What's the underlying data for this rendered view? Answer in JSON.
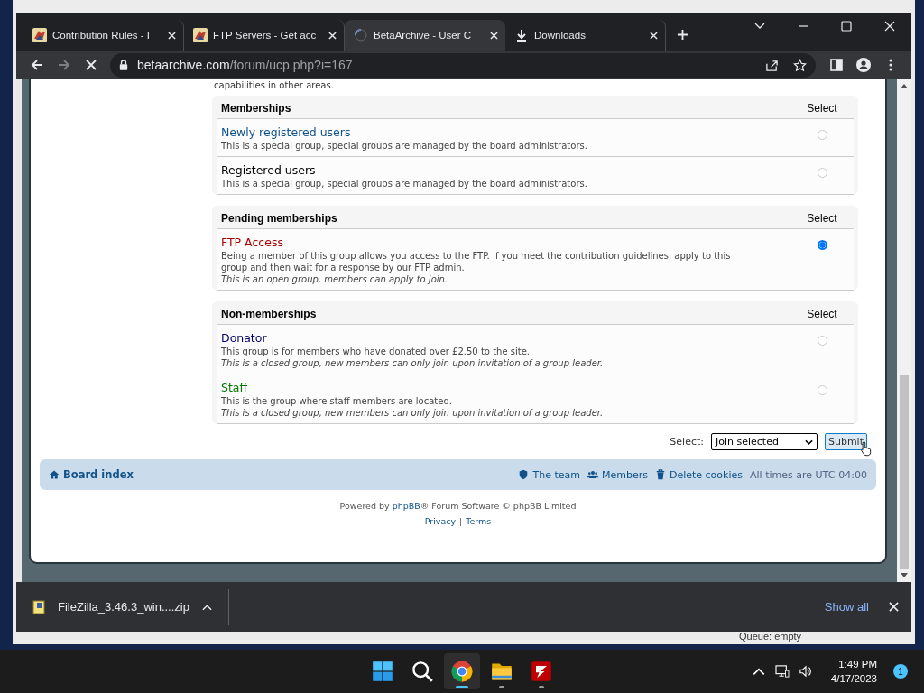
{
  "browser": {
    "tabs": [
      {
        "title": "Contribution Rules - I",
        "kind": "site",
        "selected": false
      },
      {
        "title": "FTP Servers - Get acc",
        "kind": "site",
        "selected": false
      },
      {
        "title": "BetaArchive - User C",
        "kind": "loading",
        "selected": true
      },
      {
        "title": "Downloads",
        "kind": "download",
        "selected": false
      }
    ],
    "address": {
      "host": "betaarchive.com",
      "path": "/forum/ucp.php?i=167"
    },
    "loading": true
  },
  "page": {
    "intro": "capabilities in other areas.",
    "sections": [
      {
        "heading": "Memberships",
        "select_label": "Select",
        "groups": [
          {
            "name": "Newly registered users",
            "color": "#105289",
            "description": "This is a special group, special groups are managed by the board administrators.",
            "selected": false
          },
          {
            "name": "Registered users",
            "color": "#000000",
            "description": "This is a special group, special groups are managed by the board administrators.",
            "selected": false
          }
        ]
      },
      {
        "heading": "Pending memberships",
        "select_label": "Select",
        "groups": [
          {
            "name": "FTP Access",
            "color": "#aa0000",
            "description": "Being a member of this group allows you access to the FTP. If you meet the contribution guidelines, apply to this group and then wait for a response by our FTP admin.",
            "note": "This is an open group, members can apply to join.",
            "selected": true
          }
        ]
      },
      {
        "heading": "Non-memberships",
        "select_label": "Select",
        "groups": [
          {
            "name": "Donator",
            "color": "#000066",
            "description": "This group is for members who have donated over £2.50 to the site.",
            "note": "This is a closed group, new members can only join upon invitation of a group leader.",
            "selected": false
          },
          {
            "name": "Staff",
            "color": "#007700",
            "description": "This is the group where staff members are located.",
            "note": "This is a closed group, new members can only join upon invitation of a group leader.",
            "selected": false
          }
        ]
      }
    ]
  },
  "form": {
    "label": "Select:",
    "action": "Join selected",
    "submit": "Submit"
  },
  "nav": {
    "home": "Board index",
    "links": [
      {
        "label": "The team",
        "kind": "team"
      },
      {
        "label": "Members",
        "kind": "members"
      },
      {
        "label": "Delete cookies",
        "kind": "cookies"
      }
    ],
    "timezone": "All times are UTC-04:00"
  },
  "footer": {
    "powered_before": "Powered by",
    "powered_link": "phpBB",
    "powered_after": "® Forum Software © phpBB Limited",
    "links": [
      "Privacy",
      "Terms"
    ],
    "separator": "|"
  },
  "downloads": {
    "file": "FileZilla_3.46.3_win....zip",
    "show_all": "Show all"
  },
  "background_window": {
    "status": "Queue: empty"
  },
  "taskbar": {
    "apps": [
      {
        "kind": "start",
        "running": false,
        "selected": false
      },
      {
        "kind": "search",
        "running": false,
        "selected": false
      },
      {
        "kind": "chrome",
        "running": true,
        "selected": true
      },
      {
        "kind": "explorer",
        "running": true,
        "selected": false
      },
      {
        "kind": "filezilla",
        "running": true,
        "selected": false
      }
    ],
    "time": "1:49 PM",
    "date": "4/17/2023",
    "notifications": "1"
  }
}
